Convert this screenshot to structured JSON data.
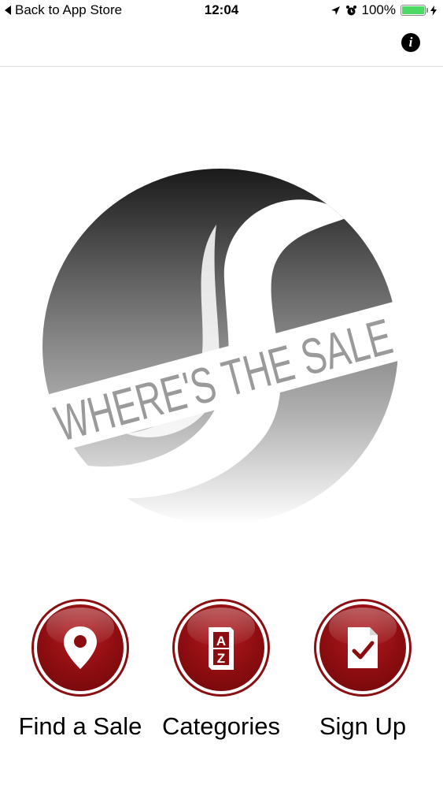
{
  "status_bar": {
    "back_label": "Back to App Store",
    "time": "12:04",
    "battery_text": "100%",
    "battery_level": 1.0,
    "battery_color": "#4cd964"
  },
  "nav": {
    "info_glyph": "i"
  },
  "logo": {
    "text": "WHERE'S THE SALE"
  },
  "actions": [
    {
      "label": "Find a Sale",
      "icon": "location-pin-icon"
    },
    {
      "label": "Categories",
      "icon": "a-z-book-icon"
    },
    {
      "label": "Sign Up",
      "icon": "document-check-icon"
    }
  ],
  "colors": {
    "accent": "#8c0d10",
    "accent_ring": "#8a0f12"
  }
}
